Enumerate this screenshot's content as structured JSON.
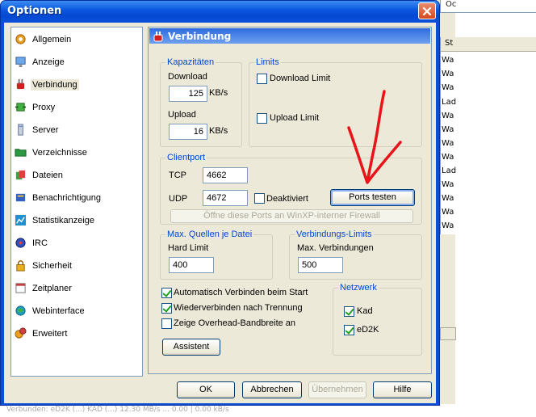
{
  "window": {
    "title": "Optionen"
  },
  "background_app": {
    "top_fragment": "Oc",
    "column_fragment": "St",
    "rows": [
      "Wa",
      "Wa",
      "Wa",
      "Lad",
      "Wa",
      "Wa",
      "Wa",
      "Wa",
      "Lad",
      "Wa",
      "Wa",
      "Wa",
      "Wa"
    ],
    "bottom_text": "Verbunden: eD2K (...) KAD (...)  12.30 MB/s  ...  0.00 | 0.00 kB/s"
  },
  "categories": [
    {
      "label": "Allgemein",
      "icon": "gear-icon"
    },
    {
      "label": "Anzeige",
      "icon": "monitor-icon"
    },
    {
      "label": "Verbindung",
      "icon": "plug-icon",
      "selected": true
    },
    {
      "label": "Proxy",
      "icon": "proxy-icon"
    },
    {
      "label": "Server",
      "icon": "server-icon"
    },
    {
      "label": "Verzeichnisse",
      "icon": "folder-icon"
    },
    {
      "label": "Dateien",
      "icon": "files-icon"
    },
    {
      "label": "Benachrichtigung",
      "icon": "notification-icon"
    },
    {
      "label": "Statistikanzeige",
      "icon": "statistics-icon"
    },
    {
      "label": "IRC",
      "icon": "irc-icon"
    },
    {
      "label": "Sicherheit",
      "icon": "lock-icon"
    },
    {
      "label": "Zeitplaner",
      "icon": "calendar-icon"
    },
    {
      "label": "Webinterface",
      "icon": "globe-icon"
    },
    {
      "label": "Erweitert",
      "icon": "advanced-gear-icon"
    }
  ],
  "panel": {
    "title": "Verbindung",
    "capacities": {
      "label": "Kapazitäten",
      "download_label": "Download",
      "download_value": "125",
      "upload_label": "Upload",
      "upload_value": "16",
      "unit": "KB/s"
    },
    "limits": {
      "label": "Limits",
      "download_limit_label": "Download Limit",
      "download_limit_checked": false,
      "upload_limit_label": "Upload Limit",
      "upload_limit_checked": false
    },
    "clientport": {
      "label": "Clientport",
      "tcp_label": "TCP",
      "tcp_value": "4662",
      "udp_label": "UDP",
      "udp_value": "4672",
      "deactivate_label": "Deaktiviert",
      "deactivate_checked": false,
      "test_ports_label": "Ports testen",
      "firewall_label": "Öffne diese Ports an WinXP-interner Firewall"
    },
    "max_sources": {
      "label": "Max. Quellen je Datei",
      "hard_limit_label": "Hard Limit",
      "hard_limit_value": "400"
    },
    "connection_limits": {
      "label": "Verbindungs-Limits",
      "max_connections_label": "Max. Verbindungen",
      "max_connections_value": "500"
    },
    "options": {
      "auto_connect_label": "Automatisch Verbinden beim Start",
      "auto_connect_checked": true,
      "reconnect_label": "Wiederverbinden nach Trennung",
      "reconnect_checked": true,
      "overhead_label": "Zeige Overhead-Bandbreite an",
      "overhead_checked": false
    },
    "network": {
      "label": "Netzwerk",
      "kad_label": "Kad",
      "kad_checked": true,
      "ed2k_label": "eD2K",
      "ed2k_checked": true
    },
    "assistant_label": "Assistent"
  },
  "buttons": {
    "ok": "OK",
    "cancel": "Abbrechen",
    "apply": "Übernehmen",
    "help": "Hilfe"
  },
  "annotation": {
    "color": "#e8141a"
  }
}
